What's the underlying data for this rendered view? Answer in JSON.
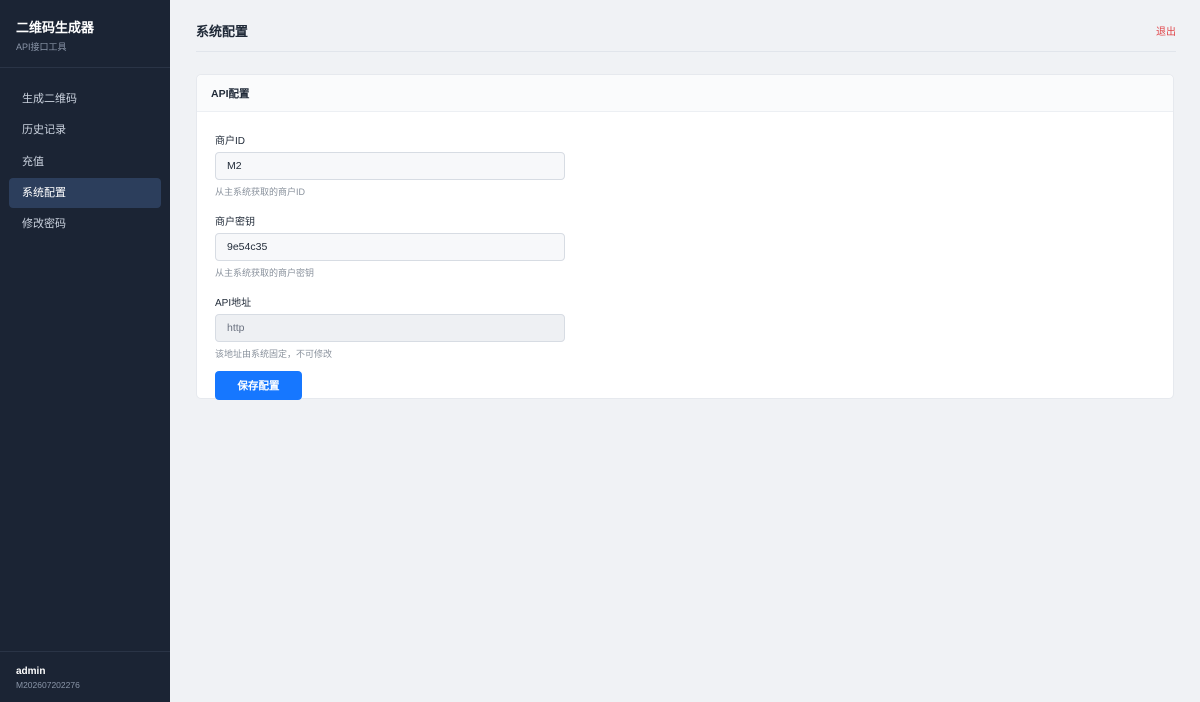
{
  "sidebar": {
    "title": "二维码生成器",
    "subtitle": "API接口工具",
    "items": [
      {
        "label": "生成二维码",
        "active": false
      },
      {
        "label": "历史记录",
        "active": false
      },
      {
        "label": "充值",
        "active": false
      },
      {
        "label": "系统配置",
        "active": true
      },
      {
        "label": "修改密码",
        "active": false
      }
    ],
    "user": {
      "name": "admin",
      "id": "M202607202276"
    }
  },
  "header": {
    "title": "系统配置",
    "logout_label": "退出"
  },
  "card": {
    "title": "API配置",
    "fields": [
      {
        "label": "商户ID",
        "value": "M2",
        "hint": "从主系统获取的商户ID",
        "readonly": false
      },
      {
        "label": "商户密钥",
        "value": "9e54c35",
        "hint": "从主系统获取的商户密钥",
        "readonly": false
      },
      {
        "label": "API地址",
        "value": "http",
        "hint": "该地址由系统固定，不可修改",
        "readonly": true
      }
    ],
    "save_label": "保存配置"
  },
  "colors": {
    "sidebar_bg": "#1b2434",
    "active_bg": "#2c3e5c",
    "primary": "#1677ff",
    "danger": "#e0464a"
  }
}
